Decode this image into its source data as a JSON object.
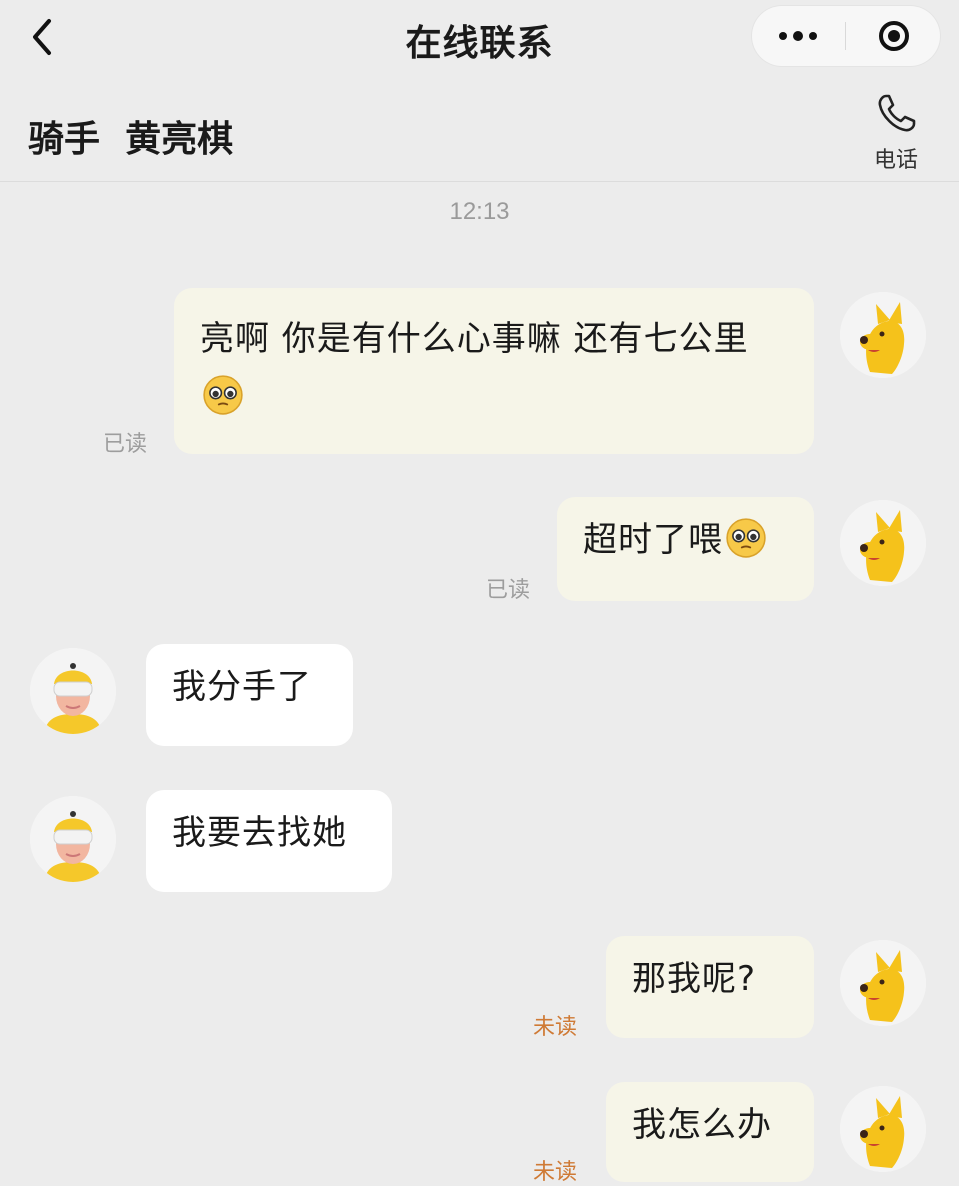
{
  "nav": {
    "title": "在线联系"
  },
  "header": {
    "rider_name": "骑手  黄亮棋",
    "phone_label": "电话"
  },
  "chat": {
    "timestamp": "12:13",
    "messages": [
      {
        "side": "out",
        "text": "亮啊 你是有什么心事嘛 还有七公里",
        "emoji": "pleading-face",
        "status": "已读"
      },
      {
        "side": "out",
        "text": "超时了喂",
        "emoji": "pleading-face",
        "status": "已读"
      },
      {
        "side": "in",
        "text": "我分手了"
      },
      {
        "side": "in",
        "text": "我要去找她"
      },
      {
        "side": "out",
        "text": "那我呢?",
        "status": "未读"
      },
      {
        "side": "out",
        "text": "我怎么办",
        "status": "未读"
      }
    ]
  },
  "colors": {
    "background": "#ececec",
    "outgoing_bubble": "#f6f5e8",
    "incoming_bubble": "#ffffff",
    "unread_status": "#cf7a35",
    "read_status": "#9d9d9d"
  }
}
